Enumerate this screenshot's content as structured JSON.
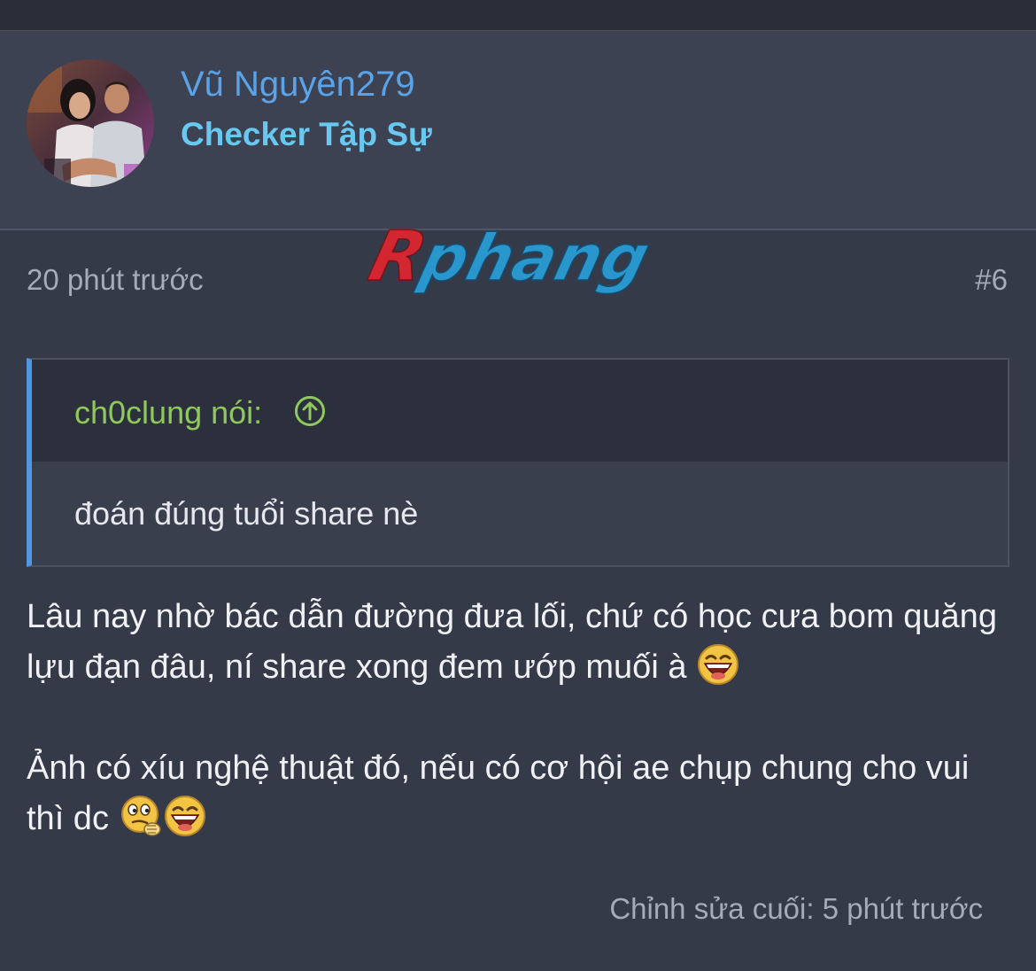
{
  "user": {
    "name": "Vũ Nguyên279",
    "title": "Checker Tập Sự"
  },
  "post": {
    "time": "20 phút trước",
    "number": "#6",
    "quote": {
      "author": "ch0clung nói:",
      "jump_icon": "arrow-up-circle-icon",
      "text": "đoán đúng tuổi share nè"
    },
    "paragraphs": [
      "Lâu nay nhờ bác dẫn đường đưa lối, chứ có học cưa bom quăng lựu đạn đâu, ní share xong đem ướp muối à",
      "Ảnh có xíu nghệ thuật đó, nếu có cơ hội ae chụp chung cho vui thì dc"
    ],
    "emojis": [
      "laughing-emoji-icon",
      "thinking-emoji-icon",
      "laughing-emoji-icon"
    ],
    "last_edit": "Chỉnh sửa cuối: 5 phút trước"
  },
  "watermark": {
    "text": "Rphang",
    "first_letter_color": "#e0262e",
    "rest_color": "#2a9fd8"
  },
  "colors": {
    "username": "#5ba3e8",
    "user_title": "#69c8ef",
    "quote_author": "#8fc95d",
    "quote_border": "#4f97e3",
    "background": "#343a48"
  }
}
